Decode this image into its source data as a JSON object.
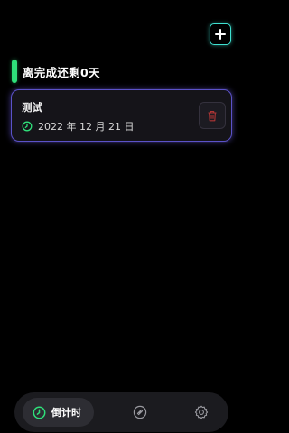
{
  "header": {
    "add_icon": "plus-icon",
    "accent_color": "#3fe0d0"
  },
  "section": {
    "title": "离完成还剩0天",
    "bar_color": "#2fe07a"
  },
  "countdowns": [
    {
      "title": "测试",
      "date": "2022 年 12 月 21 日",
      "clock_icon": "clock-icon",
      "delete_icon": "trash-icon",
      "border_color": "#5b52c8"
    }
  ],
  "bottom_nav": {
    "items": [
      {
        "label": "倒计时",
        "icon": "clock-icon",
        "active": true
      },
      {
        "label": "",
        "icon": "link-icon",
        "active": false
      },
      {
        "label": "",
        "icon": "gear-icon",
        "active": false
      }
    ]
  }
}
